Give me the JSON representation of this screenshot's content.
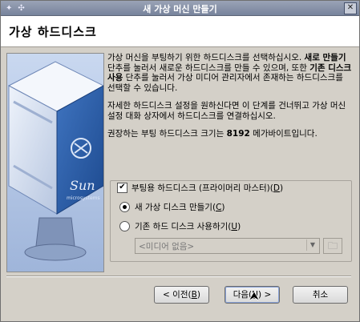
{
  "window": {
    "title": "새 가상 머신 만들기",
    "close_glyph": "✕"
  },
  "header": {
    "title": "가상 하드디스크"
  },
  "content": {
    "para1_a": "가상 머신을 부팅하기 위한 하드디스크를 선택하십시오. ",
    "para1_b": "새로 만들기",
    "para1_c": " 단추를 눌러서 새로운 하드디스크를 만들 수 있으며, 또한 ",
    "para1_d": "기존 디스크 사용",
    "para1_e": " 단추를 눌러서 가상 미디어 관리자에서 존재하는 하드디스크를 선택할 수 있습니다.",
    "para2": "자세한 하드디스크 설정을 원하신다면 이 단계를 건너뛰고 가상 머신 설정 대화 상자에서 하드디스크를 연결하십시오.",
    "para3_a": "권장하는 부팅 하드디스크 크기는 ",
    "para3_b": "8192",
    "para3_c": " 메가바이트입니다."
  },
  "options": {
    "boot_disk_label": "부팅용 하드디스크 (프라이머리 마스터)(",
    "boot_disk_key": "D",
    "boot_disk_checked": true,
    "create_new_label": "새 가상 디스크 만들기(",
    "create_new_key": "C",
    "use_existing_label": "기존 하드 디스크 사용하기(",
    "use_existing_key": "U",
    "selected": "create_new",
    "media_value": "<미디어 없음>"
  },
  "buttons": {
    "back_prefix": "< 이전(",
    "back_key": "B",
    "back_suffix": ")",
    "next_prefix": "다음(",
    "next_key": "N",
    "next_suffix": ") >",
    "cancel": "취소"
  },
  "art": {
    "brand": "Sun",
    "subbrand": "microsystems"
  },
  "colors": {
    "titlebar": "#8a93a8",
    "dialog_bg": "#d4d0c8",
    "art_bg": "#b9cbe8",
    "cube_blue": "#2a5fa8"
  },
  "icons": {
    "pin": "pin-icon",
    "arrows": "move-icon",
    "close": "close-icon",
    "folder": "folder-icon",
    "dropdown": "chevron-down-icon"
  }
}
